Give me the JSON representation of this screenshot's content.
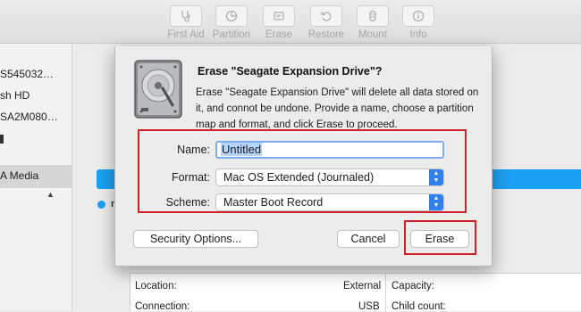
{
  "toolbar": {
    "items": [
      {
        "label": "First Aid",
        "icon": "stethoscope-icon"
      },
      {
        "label": "Partition",
        "icon": "partition-icon"
      },
      {
        "label": "Erase",
        "icon": "erase-icon"
      },
      {
        "label": "Restore",
        "icon": "restore-icon"
      },
      {
        "label": "Mount",
        "icon": "mount-icon"
      },
      {
        "label": "Info",
        "icon": "info-icon"
      }
    ]
  },
  "sidebar": {
    "items": [
      {
        "label": "S545032…"
      },
      {
        "label": "sh HD"
      },
      {
        "label": "SA2M080…"
      },
      {
        "label": "A Media"
      }
    ]
  },
  "main": {
    "partition_letter": "n",
    "info": {
      "location_label": "Location:",
      "location_value": "External",
      "connection_label": "Connection:",
      "connection_value": "USB",
      "capacity_label": "Capacity:",
      "child_count_label": "Child count:"
    }
  },
  "dialog": {
    "title": "Erase \"Seagate Expansion Drive\"?",
    "description": "Erase \"Seagate Expansion Drive\" will delete all data stored on it, and connot be undone. Provide a name, choose a partition map and format, and click Erase to proceed.",
    "name_label": "Name:",
    "name_value": "Untitled",
    "format_label": "Format:",
    "format_value": "Mac OS Extended (Journaled)",
    "scheme_label": "Scheme:",
    "scheme_value": "Master Boot Record",
    "security_button": "Security Options...",
    "cancel_button": "Cancel",
    "erase_button": "Erase"
  },
  "colors": {
    "accent": "#1ba1f2",
    "popup_arrow": "#2f80f1",
    "highlight_box": "#d0212a",
    "selection": "#b4d6fe"
  }
}
